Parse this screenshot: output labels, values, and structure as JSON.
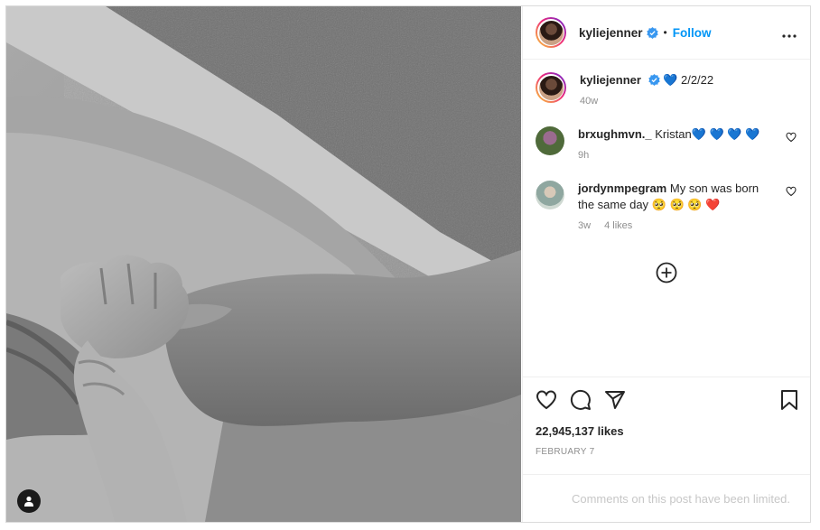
{
  "post": {
    "author": "kyliejenner",
    "follow_label": "Follow",
    "separator": "•",
    "more_icon": "more-horizontal-icon",
    "caption": {
      "author": "kyliejenner",
      "text": "💙 2/2/22",
      "age": "40w"
    },
    "comments": [
      {
        "user": "brxughmvn._",
        "text": "Kristan💙 💙 💙 💙",
        "age": "9h",
        "likes": ""
      },
      {
        "user": "jordynmpegram",
        "text": "My son was born the same day 🥺 🥺 🥺 ❤️",
        "age": "3w",
        "likes": "4 likes"
      }
    ],
    "likes": "22,945,137 likes",
    "date": "FEBRUARY 7",
    "comments_limited": "Comments on this post have been limited."
  },
  "colors": {
    "accent": "#0095f6",
    "verified": "#3897f0",
    "muted": "#8e8e8e"
  }
}
